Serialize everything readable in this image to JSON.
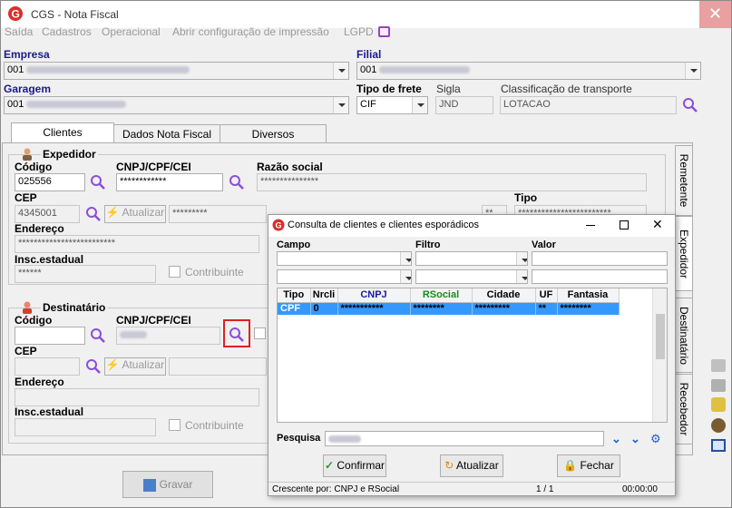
{
  "window": {
    "title": "CGS - Nota Fiscal",
    "close_glyph": "✕"
  },
  "menu": [
    "Saída",
    "Cadastros",
    "Operacional",
    "Abrir configuração de impressão",
    "LGPD"
  ],
  "empresa": {
    "label": "Empresa",
    "value": "001"
  },
  "filial": {
    "label": "Filial",
    "value": "001"
  },
  "garagem": {
    "label": "Garagem",
    "value": "001"
  },
  "tipo_frete": {
    "label": "Tipo de frete",
    "value": "CIF"
  },
  "sigla": {
    "label": "Sigla",
    "value": "JND"
  },
  "classificacao": {
    "label": "Classificação de transporte",
    "value": "LOTACAO"
  },
  "tabs": [
    "Clientes",
    "Dados Nota Fiscal",
    "Diversos"
  ],
  "side_tabs": [
    "Remetente",
    "Expedidor",
    "Destinatário",
    "Recebedor"
  ],
  "expedidor": {
    "title": "Expedidor",
    "codigo_label": "Código",
    "codigo": "025556",
    "cnpj_label": "CNPJ/CPF/CEI",
    "cnpj": "************",
    "razao_label": "Razão social",
    "razao": "***************",
    "cep_label": "CEP",
    "cep": "4345001",
    "atualizar": "Atualizar",
    "cep_desc": "*********",
    "tipo_label": "Tipo",
    "tipo_mask": "**",
    "tipo": "************************",
    "endereco_label": "Endereço",
    "endereco": "*************************",
    "insc_label": "Insc.estadual",
    "insc": "******",
    "contribuinte": "Contribuinte"
  },
  "destinatario": {
    "title": "Destinatário",
    "codigo_label": "Código",
    "cnpj_label": "CNPJ/CPF/CEI",
    "cep_label": "CEP",
    "atualizar": "Atualizar",
    "endereco_label": "Endereço",
    "insc_label": "Insc.estadual",
    "contribuinte": "Contribuinte"
  },
  "gravar": "Gravar",
  "dialog": {
    "title": "Consulta de clientes e clientes esporádicos",
    "campo_label": "Campo",
    "filtro_label": "Filtro",
    "valor_label": "Valor",
    "columns": [
      "Tipo",
      "Nrcli",
      "CNPJ",
      "RSocial",
      "Cidade",
      "UF",
      "Fantasia"
    ],
    "column_colors": [
      "#000000",
      "#000000",
      "#1a1aa0",
      "#1a8a1a",
      "#000000",
      "#000000",
      "#000000"
    ],
    "rows": [
      [
        "CPF",
        "0",
        "***********",
        "********",
        "*********",
        "**",
        "********"
      ]
    ],
    "pesquisa_label": "Pesquisa",
    "confirmar": "Confirmar",
    "atualizar": "Atualizar",
    "fechar": "Fechar",
    "status_left": "Crescente por: CNPJ e RSocial",
    "status_mid": "1 / 1",
    "status_right": "00:00:00"
  },
  "colors": {
    "accent_red": "#d9302b",
    "highlight": "#3399ff",
    "title_close": "#e8a0a0",
    "search_purple": "#8a4fd8"
  }
}
